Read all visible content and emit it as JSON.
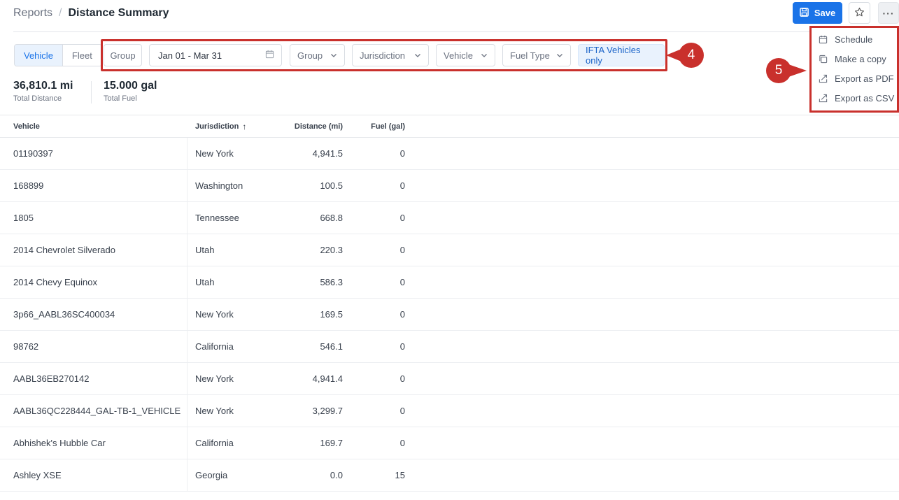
{
  "breadcrumb": {
    "root": "Reports",
    "separator": "/",
    "current": "Distance Summary"
  },
  "toolbar": {
    "save_label": "Save",
    "more_label": "···"
  },
  "menu": {
    "items": [
      {
        "label": "Schedule",
        "icon": "calendar-icon"
      },
      {
        "label": "Make a copy",
        "icon": "copy-icon"
      },
      {
        "label": "Export as PDF",
        "icon": "export-icon"
      },
      {
        "label": "Export as CSV",
        "icon": "export-icon"
      }
    ]
  },
  "segmented": {
    "vehicle": "Vehicle",
    "fleet": "Fleet"
  },
  "filters": {
    "group_label": "Group",
    "date_range": "Jan 01 - Mar 31",
    "group_dropdown": "Group",
    "jurisdiction": "Jurisdiction",
    "vehicle": "Vehicle",
    "fuel_type": "Fuel Type",
    "ifta": "IFTA Vehicles only"
  },
  "callouts": {
    "filters": "4",
    "menu": "5"
  },
  "stats": {
    "distance": {
      "value": "36,810.1 mi",
      "label": "Total Distance"
    },
    "fuel": {
      "value": "15.000 gal",
      "label": "Total Fuel"
    }
  },
  "table": {
    "headers": {
      "vehicle": "Vehicle",
      "jurisdiction": "Jurisdiction",
      "sort_arrow": "↑",
      "distance": "Distance (mi)",
      "fuel": "Fuel (gal)"
    },
    "rows": [
      {
        "vehicle": "01190397",
        "jurisdiction": "New York",
        "distance": "4,941.5",
        "fuel": "0"
      },
      {
        "vehicle": "168899",
        "jurisdiction": "Washington",
        "distance": "100.5",
        "fuel": "0"
      },
      {
        "vehicle": "1805",
        "jurisdiction": "Tennessee",
        "distance": "668.8",
        "fuel": "0"
      },
      {
        "vehicle": "2014 Chevrolet Silverado",
        "jurisdiction": "Utah",
        "distance": "220.3",
        "fuel": "0"
      },
      {
        "vehicle": "2014 Chevy Equinox",
        "jurisdiction": "Utah",
        "distance": "586.3",
        "fuel": "0"
      },
      {
        "vehicle": "3p66_AABL36SC400034",
        "jurisdiction": "New York",
        "distance": "169.5",
        "fuel": "0"
      },
      {
        "vehicle": "98762",
        "jurisdiction": "California",
        "distance": "546.1",
        "fuel": "0"
      },
      {
        "vehicle": "AABL36EB270142",
        "jurisdiction": "New York",
        "distance": "4,941.4",
        "fuel": "0"
      },
      {
        "vehicle": "AABL36QC228444_GAL-TB-1_VEHICLE",
        "jurisdiction": "New York",
        "distance": "3,299.7",
        "fuel": "0"
      },
      {
        "vehicle": "Abhishek's Hubble Car",
        "jurisdiction": "California",
        "distance": "169.7",
        "fuel": "0"
      },
      {
        "vehicle": "Ashley XSE",
        "jurisdiction": "Georgia",
        "distance": "0.0",
        "fuel": "15"
      }
    ]
  },
  "colors": {
    "accent": "#1a73e8",
    "callout": "#c9302c"
  }
}
